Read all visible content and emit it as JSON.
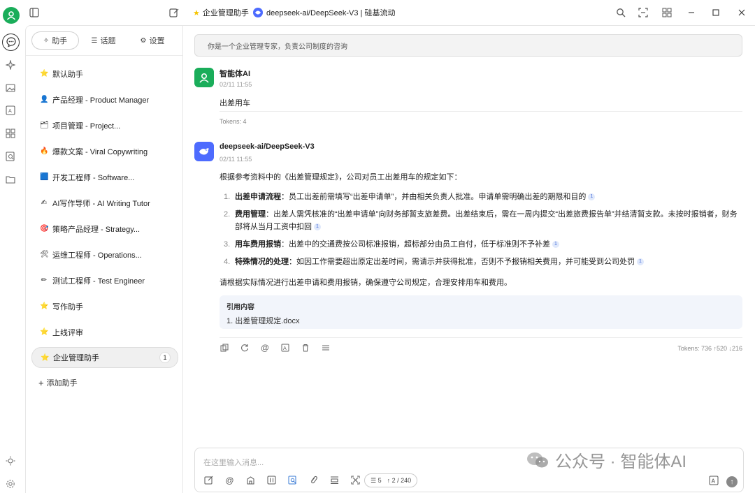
{
  "header": {
    "tab_title": "企业管理助手",
    "model_title": "deepseek-ai/DeepSeek-V3 | 硅基流动"
  },
  "sidebar": {
    "tabs": [
      {
        "label": "助手",
        "icon": "sparkle-icon"
      },
      {
        "label": "话题",
        "icon": "list-icon"
      },
      {
        "label": "设置",
        "icon": "gear-icon"
      }
    ],
    "items": [
      {
        "emoji": "⭐",
        "label": "默认助手"
      },
      {
        "emoji": "👤",
        "label": "产品经理 - Product Manager"
      },
      {
        "emoji": "🗂",
        "label": "项目管理 - Project..."
      },
      {
        "emoji": "🔥",
        "label": "爆款文案 - Viral Copywriting"
      },
      {
        "emoji": "🟦",
        "label": "开发工程师 - Software..."
      },
      {
        "emoji": "✍",
        "label": "AI写作导师 - AI Writing Tutor"
      },
      {
        "emoji": "🎯",
        "label": "策略产品经理 - Strategy..."
      },
      {
        "emoji": "🛠",
        "label": "运维工程师 - Operations..."
      },
      {
        "emoji": "✏",
        "label": "测试工程师 - Test Engineer"
      },
      {
        "emoji": "⭐",
        "label": "写作助手"
      },
      {
        "emoji": "⭐",
        "label": "上线评审"
      },
      {
        "emoji": "⭐",
        "label": "企业管理助手",
        "badge": "1",
        "active": true
      }
    ],
    "add_label": "添加助手"
  },
  "main": {
    "system_prompt": "你是一个企业管理专家，负责公司制度的咨询",
    "user_msg": {
      "name": "智能体AI",
      "time": "02/11 11:55",
      "text": "出差用车",
      "tokens": "Tokens: 4"
    },
    "ai_msg": {
      "name": "deepseek-ai/DeepSeek-V3",
      "time": "02/11 11:55",
      "intro": "根据参考资料中的《出差管理规定》，公司对员工出差用车的规定如下：",
      "points": [
        {
          "num": "1.",
          "bold": "出差申请流程",
          "text": "：员工出差前需填写“出差申请单”，并由相关负责人批准。申请单需明确出差的期限和目的",
          "cite": "1"
        },
        {
          "num": "2.",
          "bold": "费用管理",
          "text": "：出差人需凭核准的“出差申请单”向财务部暂支旅差费。出差结束后，需在一周内提交“出差旅费报告单”并结清暂支款。未按时报销者，财务部将从当月工资中扣回",
          "cite": "1"
        },
        {
          "num": "3.",
          "bold": "用车费用报销",
          "text": "：出差中的交通费按公司标准报销，超标部分由员工自付，低于标准则不予补差",
          "cite": "1"
        },
        {
          "num": "4.",
          "bold": "特殊情况的处理",
          "text": "：如因工作需要超出原定出差时间，需请示并获得批准，否则不予报销相关费用，并可能受到公司处罚",
          "cite": "1"
        }
      ],
      "outro": "请根据实际情况进行出差申请和费用报销，确保遵守公司规定，合理安排用车和费用。",
      "ref_title": "引用内容",
      "ref_item": "1. 出差管理规定.docx",
      "tokens": "Tokens: 736 ↑520 ↓216"
    }
  },
  "input": {
    "placeholder": "在这里输入消息...",
    "context_count": "5",
    "token_count": "2 / 240"
  },
  "watermark": {
    "text": "公众号 · 智能体AI"
  }
}
